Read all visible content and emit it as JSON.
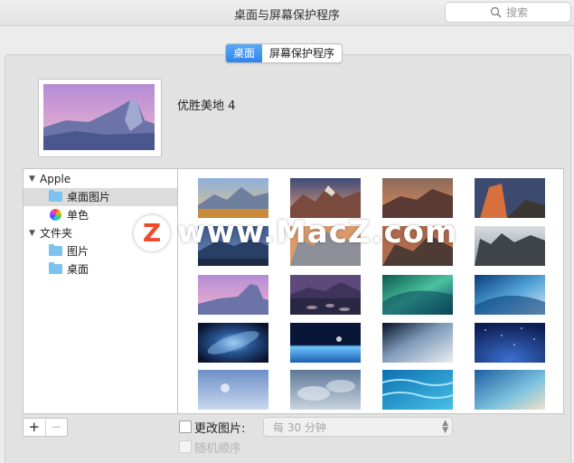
{
  "window": {
    "title": "桌面与屏幕保护程序"
  },
  "search": {
    "placeholder": "搜索"
  },
  "tabs": [
    {
      "label": "桌面",
      "active": true
    },
    {
      "label": "屏幕保护程序",
      "active": false
    }
  ],
  "current_wallpaper": {
    "name": "优胜美地 4"
  },
  "sidebar": {
    "groups": [
      {
        "label": "Apple",
        "items": [
          {
            "label": "桌面图片",
            "selected": true,
            "icon": "folder-icon"
          },
          {
            "label": "单色",
            "icon": "color-wheel-icon"
          }
        ]
      },
      {
        "label": "文件夹",
        "items": [
          {
            "label": "图片",
            "icon": "folder-icon"
          },
          {
            "label": "桌面",
            "icon": "folder-icon"
          }
        ]
      }
    ]
  },
  "thumbnails": [
    "yosemite-sunset",
    "sierra-mountains",
    "sierra-dusk",
    "el-capitan-night",
    "mountain-lake-dusk",
    "sierra-peaks",
    "el-capitan-rocks",
    "yosemite-forest",
    "yosemite-pink",
    "lake-stones",
    "mavericks-wave-green",
    "mavericks-wave-blue",
    "galaxy-blue",
    "earth-sunrise",
    "earth-horizon",
    "starry-night",
    "sky-moon",
    "clouds",
    "ocean-ripples",
    "beach-aerial"
  ],
  "watermark": {
    "letter": "Z",
    "text": "www.MacZ.com"
  },
  "controls": {
    "add_label": "+",
    "remove_label": "−",
    "change_picture_label": "更改图片:",
    "interval_value": "每 30 分钟",
    "random_order_label": "随机顺序"
  },
  "colors": {
    "accent": "#2f84ea",
    "panel": "#e2e2e2",
    "watermark": "#ef4b2d"
  }
}
